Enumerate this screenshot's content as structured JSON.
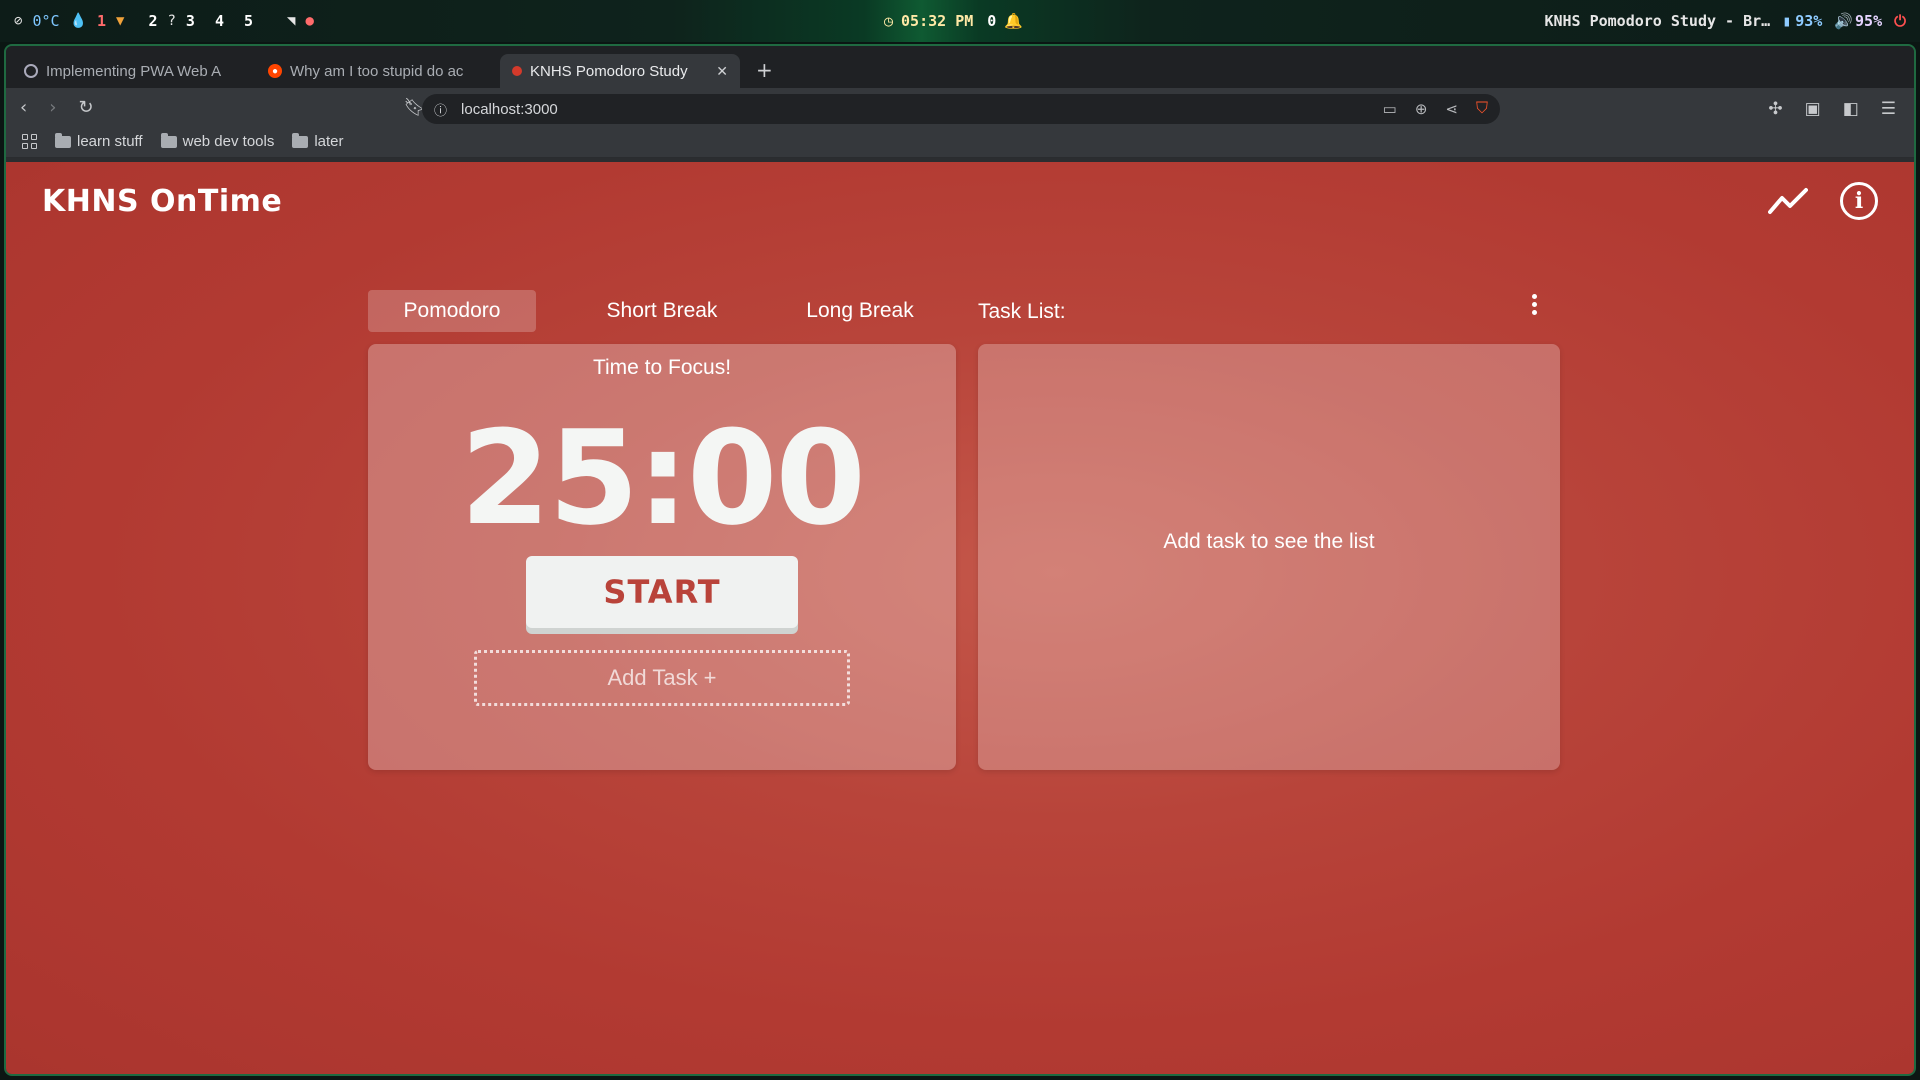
{
  "system_bar": {
    "temperature": "0°C",
    "workspaces": [
      "1",
      "2",
      "3",
      "4",
      "5"
    ],
    "active_workspace": "1",
    "clock": "05:32 PM",
    "notifications_count": "0",
    "window_title": "KNHS Pomodoro Study - Br…",
    "battery": "93%",
    "volume": "95%"
  },
  "browser": {
    "tabs": [
      {
        "title": "Implementing PWA Web A",
        "active": false
      },
      {
        "title": "Why am I too stupid do ac",
        "active": false
      },
      {
        "title": "KNHS Pomodoro Study",
        "active": true
      }
    ],
    "new_tab": "+",
    "url": "localhost:3000",
    "bookmarks": [
      "learn stuff",
      "web dev tools",
      "later"
    ]
  },
  "app": {
    "logo": "KHNS OnTime",
    "modes": [
      "Pomodoro",
      "Short Break",
      "Long Break"
    ],
    "active_mode": "Pomodoro",
    "focus_message": "Time to Focus!",
    "timer": "25:00",
    "start_label": "START",
    "add_task_label": "Add Task +",
    "task_list_label": "Task List:",
    "task_list_empty": "Add task to see the list",
    "accent_color": "#b9433a"
  }
}
